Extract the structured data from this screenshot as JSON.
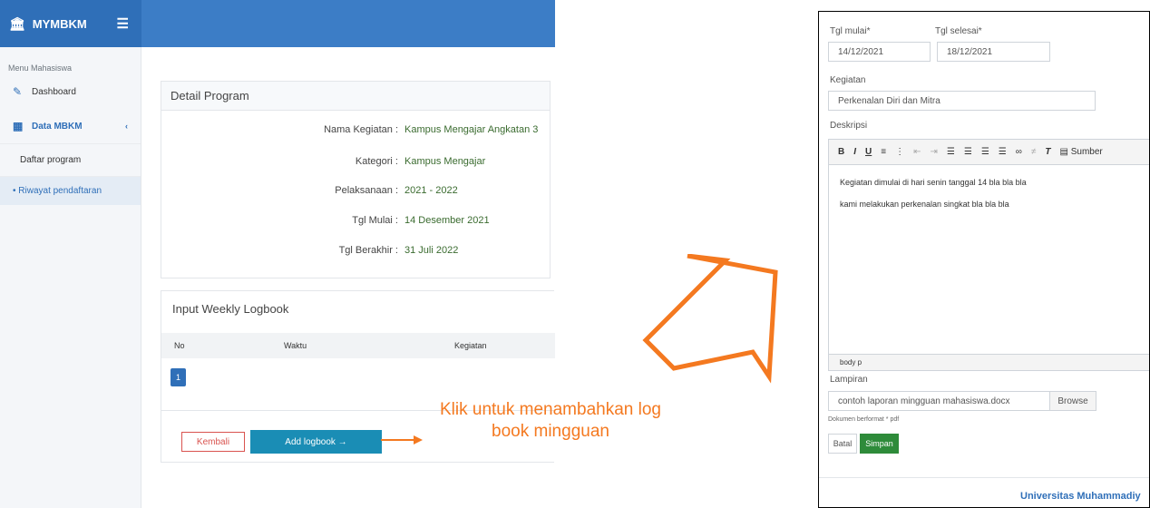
{
  "app": {
    "brand": "MYMBKM",
    "sidebar": {
      "header": "Menu Mahasiswa",
      "items": [
        {
          "label": "Dashboard"
        },
        {
          "label": "Data MBKM"
        }
      ],
      "subitems": [
        {
          "label": "Daftar program"
        },
        {
          "label": "• Riwayat pendaftaran"
        }
      ]
    },
    "detail": {
      "title": "Detail Program",
      "rows": [
        {
          "label": "Nama Kegiatan :",
          "value": "Kampus Mengajar Angkatan 3"
        },
        {
          "label": "Kategori :",
          "value": "Kampus Mengajar"
        },
        {
          "label": "Pelaksanaan :",
          "value": "2021 - 2022"
        },
        {
          "label": "Tgl Mulai :",
          "value": "14 Desember 2021"
        },
        {
          "label": "Tgl Berakhir :",
          "value": "31 Juli 2022"
        }
      ]
    },
    "logbook": {
      "title": "Input Weekly Logbook",
      "columns": [
        "No",
        "Waktu",
        "Kegiatan"
      ],
      "page": "1",
      "back_label": "Kembali",
      "add_label": "Add logbook →"
    }
  },
  "annotation": {
    "line1": "Klik untuk menambahkan log",
    "line2": "book mingguan"
  },
  "form": {
    "start_label": "Tgl mulai*",
    "end_label": "Tgl selesai*",
    "start_value": "14/12/2021",
    "end_value": "18/12/2021",
    "activity_label": "Kegiatan",
    "activity_value": "Perkenalan Diri dan Mitra",
    "desc_label": "Deskripsi",
    "toolbar_source": "Sumber",
    "desc_lines": [
      "Kegiatan dimulai di hari senin tanggal 14 bla bla bla",
      "kami melakukan perkenalan singkat bla bla bla"
    ],
    "editor_path": "body  p",
    "attach_label": "Lampiran",
    "attach_value": "contoh laporan mingguan mahasiswa.docx",
    "browse_label": "Browse",
    "attach_hint": "Dokumen berformat * pdf",
    "cancel_label": "Batal",
    "save_label": "Simpan",
    "footer": "Universitas Muhammadiy"
  },
  "colors": {
    "accent": "#2f6fb8",
    "annotation": "#f47920",
    "save": "#2e8b3a"
  }
}
